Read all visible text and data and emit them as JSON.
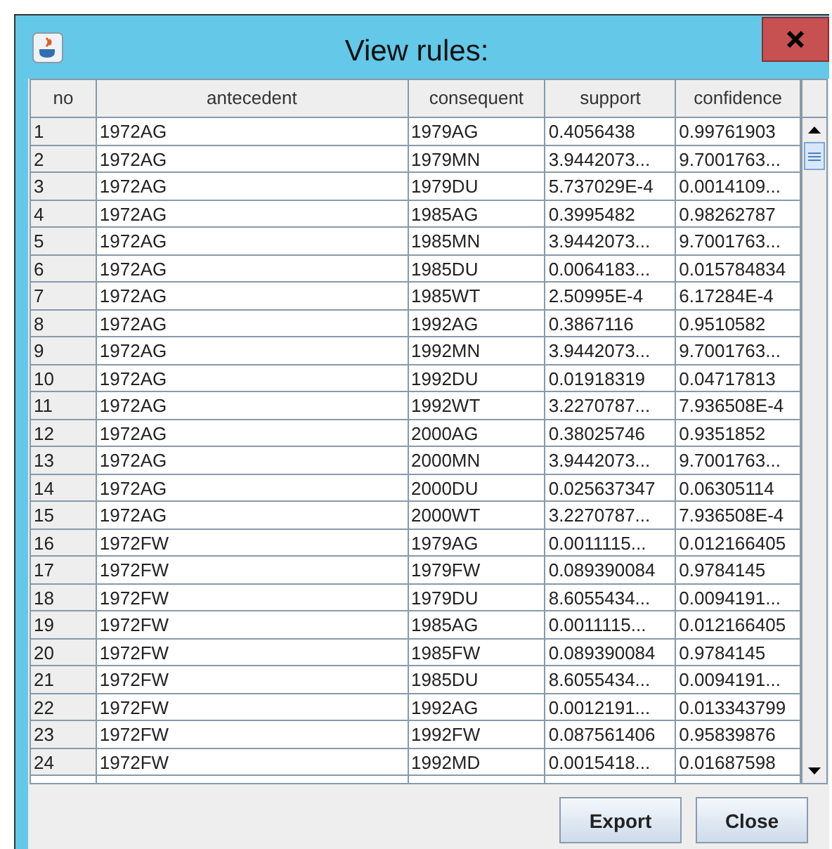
{
  "window": {
    "title": "View rules:"
  },
  "table": {
    "columns": [
      "no",
      "antecedent",
      "consequent",
      "support",
      "confidence"
    ],
    "rows": [
      [
        "1",
        "1972AG",
        "1979AG",
        "0.4056438",
        "0.99761903"
      ],
      [
        "2",
        "1972AG",
        "1979MN",
        "3.9442073...",
        "9.7001763..."
      ],
      [
        "3",
        "1972AG",
        "1979DU",
        "5.737029E-4",
        "0.0014109..."
      ],
      [
        "4",
        "1972AG",
        "1985AG",
        "0.3995482",
        "0.98262787"
      ],
      [
        "5",
        "1972AG",
        "1985MN",
        "3.9442073...",
        "9.7001763..."
      ],
      [
        "6",
        "1972AG",
        "1985DU",
        "0.0064183...",
        "0.015784834"
      ],
      [
        "7",
        "1972AG",
        "1985WT",
        "2.50995E-4",
        "6.17284E-4"
      ],
      [
        "8",
        "1972AG",
        "1992AG",
        "0.3867116",
        "0.9510582"
      ],
      [
        "9",
        "1972AG",
        "1992MN",
        "3.9442073...",
        "9.7001763..."
      ],
      [
        "10",
        "1972AG",
        "1992DU",
        "0.01918319",
        "0.04717813"
      ],
      [
        "11",
        "1972AG",
        "1992WT",
        "3.2270787...",
        "7.936508E-4"
      ],
      [
        "12",
        "1972AG",
        "2000AG",
        "0.38025746",
        "0.9351852"
      ],
      [
        "13",
        "1972AG",
        "2000MN",
        "3.9442073...",
        "9.7001763..."
      ],
      [
        "14",
        "1972AG",
        "2000DU",
        "0.025637347",
        "0.06305114"
      ],
      [
        "15",
        "1972AG",
        "2000WT",
        "3.2270787...",
        "7.936508E-4"
      ],
      [
        "16",
        "1972FW",
        "1979AG",
        "0.0011115...",
        "0.012166405"
      ],
      [
        "17",
        "1972FW",
        "1979FW",
        "0.089390084",
        "0.9784145"
      ],
      [
        "18",
        "1972FW",
        "1979DU",
        "8.6055434...",
        "0.0094191..."
      ],
      [
        "19",
        "1972FW",
        "1985AG",
        "0.0011115...",
        "0.012166405"
      ],
      [
        "20",
        "1972FW",
        "1985FW",
        "0.089390084",
        "0.9784145"
      ],
      [
        "21",
        "1972FW",
        "1985DU",
        "8.6055434...",
        "0.0094191..."
      ],
      [
        "22",
        "1972FW",
        "1992AG",
        "0.0012191...",
        "0.013343799"
      ],
      [
        "23",
        "1972FW",
        "1992FW",
        "0.087561406",
        "0.95839876"
      ],
      [
        "24",
        "1972FW",
        "1992MD",
        "0.0015418...",
        "0.01687598"
      ]
    ]
  },
  "buttons": [
    "Export",
    "Close"
  ]
}
